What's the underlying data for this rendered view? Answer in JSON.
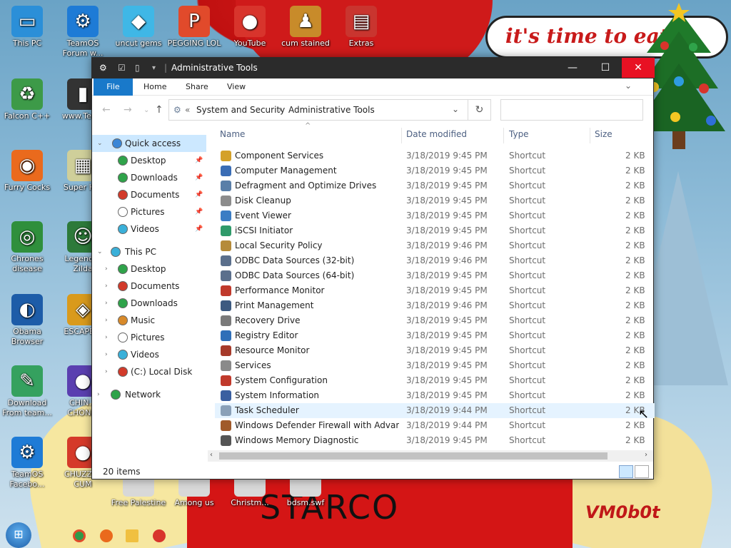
{
  "desktop": {
    "speech_text": "it's time to eat",
    "bottom_text": "STARCO",
    "signature_text": "VM0b0t",
    "icons": [
      {
        "label": "This PC",
        "color": "#2b8fd8",
        "glyph": "▭"
      },
      {
        "label": "TeamOS Forum w...",
        "color": "#1e7bd6",
        "glyph": "⚙"
      },
      {
        "label": "uncut gems",
        "color": "#3fb7e6",
        "glyph": "◆"
      },
      {
        "label": "PEGGING LOL",
        "color": "#e14a2b",
        "glyph": "P"
      },
      {
        "label": "YouTube",
        "color": "#d8342c",
        "glyph": "●"
      },
      {
        "label": "cum stained",
        "color": "#c88b2a",
        "glyph": "♟"
      },
      {
        "label": "Extras",
        "color": "#c9352f",
        "glyph": "▤"
      },
      {
        "label": "Falcon C++",
        "color": "#3d9a48",
        "glyph": "♻"
      },
      {
        "label": "www.Tea...",
        "color": "#333333",
        "glyph": "▮"
      },
      {
        "label": "Furry Cocks",
        "color": "#ea6a1d",
        "glyph": "◉"
      },
      {
        "label": "Super H...",
        "color": "#cfcf9a",
        "glyph": "▦"
      },
      {
        "label": "Chrones disease",
        "color": "#2f8f3c",
        "glyph": "◎"
      },
      {
        "label": "Legend... Zilda",
        "color": "#2d7a3a",
        "glyph": "☺"
      },
      {
        "label": "Obama Browser",
        "color": "#1d5ca8",
        "glyph": "◐"
      },
      {
        "label": "ESCAPE...",
        "color": "#d99a1c",
        "glyph": "◈"
      },
      {
        "label": "Download From team...",
        "color": "#35a15f",
        "glyph": "✎"
      },
      {
        "label": "CHIN... CHON...",
        "color": "#5a3fb0",
        "glyph": "●"
      },
      {
        "label": "TeamOS Facebo...",
        "color": "#1e7bd6",
        "glyph": "⚙"
      },
      {
        "label": "CHUZZLE CUM",
        "color": "#d53a2a",
        "glyph": "●"
      },
      {
        "label": "Free Palestine",
        "color": "#d8d8d8",
        "glyph": " "
      },
      {
        "label": "Among us",
        "color": "#d8d8d8",
        "glyph": " "
      },
      {
        "label": "Christm...",
        "color": "#d8d8d8",
        "glyph": " "
      },
      {
        "label": "bdsm.swf",
        "color": "#d8d8d8",
        "glyph": " "
      }
    ]
  },
  "window": {
    "title": "Administrative Tools",
    "controls": {
      "minimize": "—",
      "maximize": "☐",
      "close": "✕"
    },
    "ribbon_tabs": [
      "File",
      "Home",
      "Share",
      "View"
    ],
    "breadcrumb": {
      "separator": "«",
      "items": [
        "System and Security",
        "Administrative Tools"
      ],
      "arrow": "›"
    },
    "search_placeholder": "",
    "columns": {
      "name": "Name",
      "date": "Date modified",
      "type": "Type",
      "size": "Size"
    },
    "status": "20 items"
  },
  "nav_pane": [
    {
      "label": "Quick access",
      "icon_color": "#3a86d6",
      "pinned": false,
      "expanded": true
    },
    {
      "label": "Desktop",
      "icon_color": "#2fa34a",
      "pinned": true
    },
    {
      "label": "Downloads",
      "icon_color": "#2fa34a",
      "pinned": true
    },
    {
      "label": "Documents",
      "icon_color": "#d23a2a",
      "pinned": true
    },
    {
      "label": "Pictures",
      "icon_color": "#ffffff",
      "pinned": true
    },
    {
      "label": "Videos",
      "icon_color": "#3ab0d9",
      "pinned": true
    },
    {
      "label": "This PC",
      "icon_color": "#3ab0d9",
      "pinned": false,
      "expanded": true
    },
    {
      "label": "Desktop",
      "icon_color": "#2fa34a",
      "pinned": false
    },
    {
      "label": "Documents",
      "icon_color": "#d23a2a",
      "pinned": false
    },
    {
      "label": "Downloads",
      "icon_color": "#2fa34a",
      "pinned": false
    },
    {
      "label": "Music",
      "icon_color": "#d88a2a",
      "pinned": false
    },
    {
      "label": "Pictures",
      "icon_color": "#ffffff",
      "pinned": false
    },
    {
      "label": "Videos",
      "icon_color": "#3ab0d9",
      "pinned": false
    },
    {
      "label": "(C:) Local Disk",
      "icon_color": "#d23a2a",
      "pinned": false
    },
    {
      "label": "Network",
      "icon_color": "#2fa34a",
      "pinned": false
    }
  ],
  "files": [
    {
      "name": "Component Services",
      "date": "3/18/2019 9:45 PM",
      "type": "Shortcut",
      "size": "2 KB",
      "icon_color": "#d4a12a"
    },
    {
      "name": "Computer Management",
      "date": "3/18/2019 9:45 PM",
      "type": "Shortcut",
      "size": "2 KB",
      "icon_color": "#3a6db5"
    },
    {
      "name": "Defragment and Optimize Drives",
      "date": "3/18/2019 9:45 PM",
      "type": "Shortcut",
      "size": "2 KB",
      "icon_color": "#5a7fa8"
    },
    {
      "name": "Disk Cleanup",
      "date": "3/18/2019 9:45 PM",
      "type": "Shortcut",
      "size": "2 KB",
      "icon_color": "#8c8c8c"
    },
    {
      "name": "Event Viewer",
      "date": "3/18/2019 9:45 PM",
      "type": "Shortcut",
      "size": "2 KB",
      "icon_color": "#3b7dc4"
    },
    {
      "name": "iSCSI Initiator",
      "date": "3/18/2019 9:45 PM",
      "type": "Shortcut",
      "size": "2 KB",
      "icon_color": "#2f9a6a"
    },
    {
      "name": "Local Security Policy",
      "date": "3/18/2019 9:46 PM",
      "type": "Shortcut",
      "size": "2 KB",
      "icon_color": "#b58b3a"
    },
    {
      "name": "ODBC Data Sources (32-bit)",
      "date": "3/18/2019 9:46 PM",
      "type": "Shortcut",
      "size": "2 KB",
      "icon_color": "#5b6f8c"
    },
    {
      "name": "ODBC Data Sources (64-bit)",
      "date": "3/18/2019 9:45 PM",
      "type": "Shortcut",
      "size": "2 KB",
      "icon_color": "#5b6f8c"
    },
    {
      "name": "Performance Monitor",
      "date": "3/18/2019 9:45 PM",
      "type": "Shortcut",
      "size": "2 KB",
      "icon_color": "#c0392b"
    },
    {
      "name": "Print Management",
      "date": "3/18/2019 9:46 PM",
      "type": "Shortcut",
      "size": "2 KB",
      "icon_color": "#3d5a80"
    },
    {
      "name": "Recovery Drive",
      "date": "3/18/2019 9:45 PM",
      "type": "Shortcut",
      "size": "2 KB",
      "icon_color": "#7a7a7a"
    },
    {
      "name": "Registry Editor",
      "date": "3/18/2019 9:45 PM",
      "type": "Shortcut",
      "size": "2 KB",
      "icon_color": "#2f6fb8"
    },
    {
      "name": "Resource Monitor",
      "date": "3/18/2019 9:45 PM",
      "type": "Shortcut",
      "size": "2 KB",
      "icon_color": "#a63a2a"
    },
    {
      "name": "Services",
      "date": "3/18/2019 9:45 PM",
      "type": "Shortcut",
      "size": "2 KB",
      "icon_color": "#8a8a8a"
    },
    {
      "name": "System Configuration",
      "date": "3/18/2019 9:45 PM",
      "type": "Shortcut",
      "size": "2 KB",
      "icon_color": "#c0392b"
    },
    {
      "name": "System Information",
      "date": "3/18/2019 9:45 PM",
      "type": "Shortcut",
      "size": "2 KB",
      "icon_color": "#3a5fa0"
    },
    {
      "name": "Task Scheduler",
      "date": "3/18/2019 9:44 PM",
      "type": "Shortcut",
      "size": "2 KB",
      "icon_color": "#8aa0b8"
    },
    {
      "name": "Windows Defender Firewall with Advanc...",
      "date": "3/18/2019 9:44 PM",
      "type": "Shortcut",
      "size": "2 KB",
      "icon_color": "#a05a2a"
    },
    {
      "name": "Windows Memory Diagnostic",
      "date": "3/18/2019 9:45 PM",
      "type": "Shortcut",
      "size": "2 KB",
      "icon_color": "#555555"
    }
  ]
}
